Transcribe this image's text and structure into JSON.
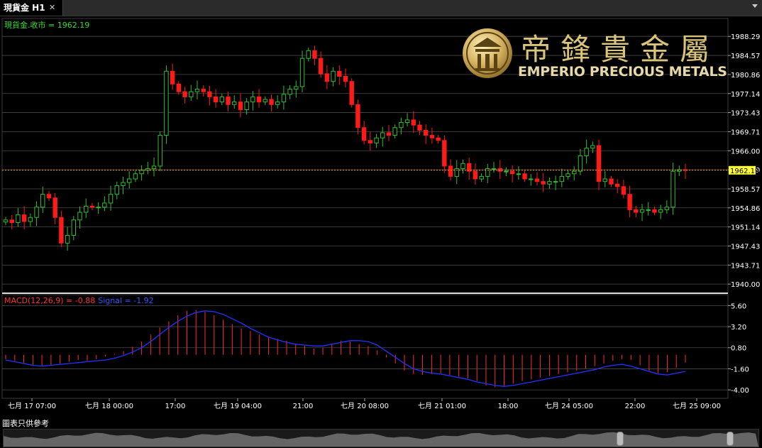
{
  "tab": {
    "title": "現貨金 H1",
    "close": "✕"
  },
  "price_label": {
    "text": "現貨金.收市 = 1962.19"
  },
  "macd_label": {
    "macd": "MACD(12,26,9) = -0.88",
    "signal": "Signal = -1.92"
  },
  "logo": {
    "name_cn": "帝鋒貴金屬",
    "name_en": "EMPERIO PRECIOUS METALS"
  },
  "disclaimer": "圖表只供參考",
  "colors": {
    "up": "#2fbf2f",
    "down": "#ff1a1a",
    "macd_hist": "#ff2a2a",
    "signal": "#2233ff",
    "current_line": "#ff9900",
    "current_tag_bg": "#ffff33",
    "grid": "#4a4a4a"
  },
  "chart_data": [
    {
      "type": "candlestick",
      "series_label": "現貨金.收市",
      "current_value": 1962.19,
      "current_tag": "1962.19",
      "ylim": [
        1938.5,
        1991.5
      ],
      "y_ticks": [
        "1988.29",
        "1984.57",
        "1980.86",
        "1977.14",
        "1973.43",
        "1969.71",
        "1966.00",
        "1962.29",
        "1958.57",
        "1954.86",
        "1951.14",
        "1947.43",
        "1943.71",
        "1940.00"
      ],
      "x_tick_labels": [
        "七月 17 07:00",
        "七月 18 00:00",
        "17:00",
        "七月 19 04:00",
        "21:00",
        "七月 20 08:00",
        "七月 21 01:00",
        "18:00",
        "七月 24 05:00",
        "22:00",
        "七月 25 09:00"
      ],
      "close_path": [
        1952.5,
        1952.0,
        1953.5,
        1952.2,
        1953.0,
        1955.0,
        1957.5,
        1956.8,
        1953.0,
        1948.0,
        1949.5,
        1952.5,
        1954.0,
        1955.2,
        1955.0,
        1955.0,
        1955.8,
        1957.5,
        1959.2,
        1959.8,
        1960.5,
        1961.5,
        1962.2,
        1962.5,
        1963.0,
        1969.0,
        1981.5,
        1979.0,
        1977.5,
        1976.5,
        1977.5,
        1978.0,
        1977.5,
        1976.5,
        1975.5,
        1976.5,
        1975.0,
        1975.5,
        1974.0,
        1975.5,
        1976.5,
        1975.5,
        1976.0,
        1975.0,
        1975.5,
        1977.0,
        1978.0,
        1978.5,
        1984.0,
        1985.5,
        1984.0,
        1981.0,
        1979.5,
        1981.5,
        1980.5,
        1979.5,
        1975.0,
        1970.5,
        1968.0,
        1967.5,
        1968.5,
        1969.5,
        1969.0,
        1970.5,
        1971.5,
        1972.0,
        1971.0,
        1970.0,
        1969.0,
        1968.5,
        1968.0,
        1963.0,
        1961.0,
        1962.5,
        1963.5,
        1962.0,
        1960.5,
        1961.0,
        1962.5,
        1962.5,
        1962.0,
        1962.0,
        1961.5,
        1961.5,
        1960.5,
        1960.5,
        1960.0,
        1959.5,
        1960.0,
        1960.0,
        1961.0,
        1961.5,
        1962.0,
        1965.0,
        1966.5,
        1967.0,
        1960.0,
        1960.5,
        1959.5,
        1959.0,
        1957.5,
        1954.5,
        1954.0,
        1954.5,
        1954.5,
        1954.0,
        1954.5,
        1955.0,
        1962.0,
        1962.3,
        1962.19
      ]
    },
    {
      "type": "macd",
      "params": "12,26,9",
      "macd": -0.88,
      "signal": -1.92,
      "ylim": [
        -4.8,
        6.6
      ],
      "y_ticks": [
        "5.60",
        "3.20",
        "0.80",
        "-1.60",
        "-4.00"
      ],
      "histogram_path": [
        -0.5,
        -0.7,
        -1.0,
        -1.2,
        -1.3,
        -1.2,
        -1.0,
        -0.8,
        -0.6,
        -0.7,
        -0.5,
        -0.2,
        0.1,
        0.4,
        0.9,
        1.5,
        2.3,
        3.1,
        3.8,
        4.5,
        5.0,
        5.1,
        4.9,
        4.5,
        4.0,
        3.5,
        3.0,
        2.7,
        2.3,
        2.0,
        1.8,
        1.6,
        1.2,
        1.0,
        0.7,
        0.8,
        1.2,
        1.6,
        1.5,
        1.2,
        1.0,
        0.5,
        -0.3,
        -1.0,
        -1.8,
        -2.2,
        -2.3,
        -2.2,
        -2.1,
        -2.3,
        -2.5,
        -2.7,
        -3.0,
        -3.5,
        -3.7,
        -3.6,
        -3.3,
        -3.0,
        -2.8,
        -2.6,
        -2.4,
        -2.2,
        -2.0,
        -1.8,
        -1.6,
        -1.3,
        -1.0,
        -0.7,
        -0.5,
        -0.6,
        -1.2,
        -1.8,
        -2.1,
        -2.0,
        -1.5,
        -0.9
      ],
      "signal_path": [
        -0.6,
        -0.8,
        -1.0,
        -1.2,
        -1.3,
        -1.2,
        -1.1,
        -1.0,
        -0.9,
        -0.8,
        -0.7,
        -0.6,
        -0.4,
        -0.1,
        0.3,
        0.8,
        1.5,
        2.3,
        3.1,
        3.8,
        4.4,
        4.8,
        5.0,
        4.9,
        4.6,
        4.1,
        3.6,
        3.0,
        2.5,
        2.0,
        1.7,
        1.4,
        1.2,
        1.1,
        1.0,
        1.0,
        1.2,
        1.4,
        1.6,
        1.6,
        1.5,
        1.1,
        0.4,
        -0.3,
        -1.0,
        -1.6,
        -1.9,
        -2.1,
        -2.2,
        -2.4,
        -2.6,
        -2.8,
        -3.1,
        -3.3,
        -3.5,
        -3.6,
        -3.5,
        -3.3,
        -3.1,
        -2.9,
        -2.7,
        -2.5,
        -2.3,
        -2.1,
        -1.9,
        -1.7,
        -1.4,
        -1.2,
        -1.1,
        -1.3,
        -1.6,
        -1.9,
        -2.2,
        -2.3,
        -2.1,
        -1.9
      ]
    }
  ]
}
